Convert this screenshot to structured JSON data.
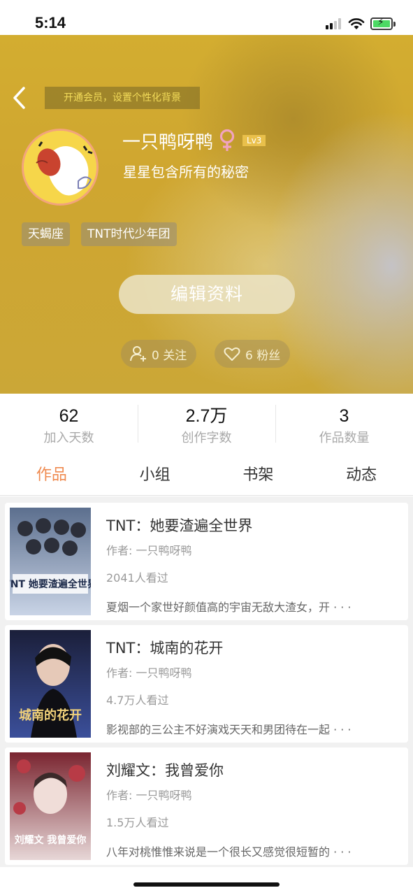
{
  "status_bar": {
    "time": "5:14"
  },
  "profile": {
    "banner": "开通会员，设置个性化背景",
    "username": "一只鸭呀鸭",
    "gender_symbol": "♀",
    "level": "Lv3",
    "signature": "星星包含所有的秘密",
    "tags": [
      "天蝎座",
      "TNT时代少年团"
    ],
    "edit_button": "编辑资料",
    "following_label": "0 关注",
    "fans_label": "6 粉丝"
  },
  "stats": [
    {
      "value": "62",
      "label": "加入天数"
    },
    {
      "value": "2.7万",
      "label": "创作字数"
    },
    {
      "value": "3",
      "label": "作品数量"
    }
  ],
  "tabs": [
    {
      "label": "作品",
      "active": true
    },
    {
      "label": "小组",
      "active": false
    },
    {
      "label": "书架",
      "active": false
    },
    {
      "label": "动态",
      "active": false
    }
  ],
  "works": [
    {
      "title": "TNT：她要渣遍全世界",
      "author": "作者: 一只鸭呀鸭",
      "views": "2041人看过",
      "description": "夏烟一个家世好颜值高的宇宙无敌大渣女，开 · · ·",
      "cover_text": "TNT 她要渣遍全世界",
      "cover_colors": [
        "#5c6f8e",
        "#c9d4e6"
      ]
    },
    {
      "title": "TNT：城南的花开",
      "author": "作者: 一只鸭呀鸭",
      "views": "4.7万人看过",
      "description": "影视部的三公主不好演戏天天和男团待在一起 · · ·",
      "cover_text": "城南的花开",
      "cover_colors": [
        "#1b1f3a",
        "#3b4f9a"
      ]
    },
    {
      "title": "刘耀文：我曾爱你",
      "author": "作者: 一只鸭呀鸭",
      "views": "1.5万人看过",
      "description": "八年对桃惟惟来说是一个很长又感觉很短暂的 · · ·",
      "cover_text": "刘耀文 我曾爱你",
      "cover_colors": [
        "#7a2530",
        "#e7d7d7"
      ]
    }
  ]
}
